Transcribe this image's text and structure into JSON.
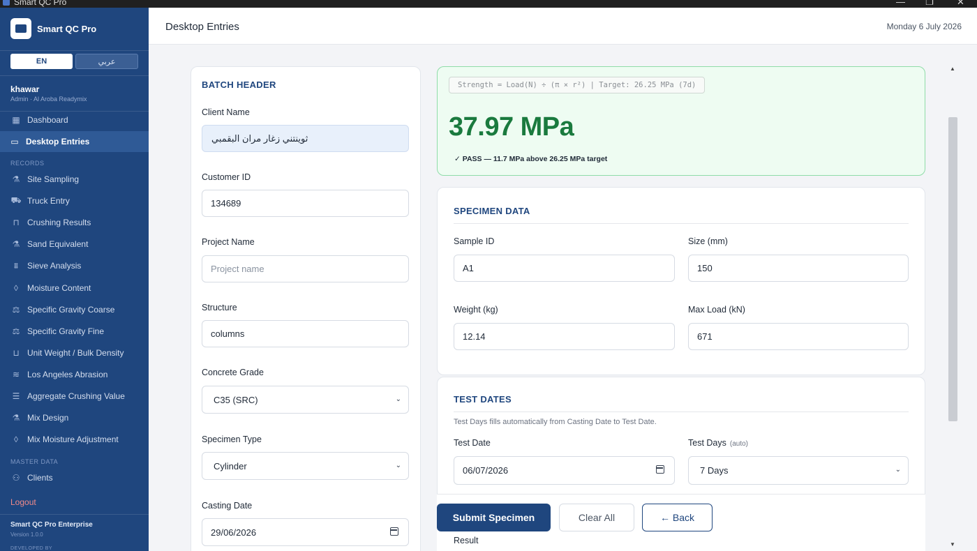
{
  "window": {
    "title": "Smart QC Pro",
    "min": "—",
    "max": "❐",
    "close": "✕"
  },
  "sidebar": {
    "brand": "Smart QC Pro",
    "lang_en": "EN",
    "lang_ar": "عربي",
    "user_name": "khawar",
    "user_role": "Admin · Al Aroba Readymix",
    "nav": [
      {
        "label": "Dashboard",
        "icon": "grid-icon",
        "glyph": "▦"
      },
      {
        "label": "Desktop Entries",
        "icon": "monitor-icon",
        "glyph": "▭"
      }
    ],
    "records_label": "RECORDS",
    "records": [
      {
        "label": "Site Sampling",
        "icon": "flask-icon",
        "glyph": "⚗"
      },
      {
        "label": "Truck Entry",
        "icon": "truck-icon",
        "glyph": "⛟"
      },
      {
        "label": "Crushing Results",
        "icon": "lock-icon",
        "glyph": "⊓"
      },
      {
        "label": "Sand Equivalent",
        "icon": "flask-icon",
        "glyph": "⚗"
      },
      {
        "label": "Sieve Analysis",
        "icon": "sieve-icon",
        "glyph": "⩩"
      },
      {
        "label": "Moisture Content",
        "icon": "droplet-icon",
        "glyph": "◊"
      },
      {
        "label": "Specific Gravity Coarse",
        "icon": "scale-icon",
        "glyph": "⚖"
      },
      {
        "label": "Specific Gravity Fine",
        "icon": "scale-icon",
        "glyph": "⚖"
      },
      {
        "label": "Unit Weight / Bulk Density",
        "icon": "beaker-icon",
        "glyph": "⊔"
      },
      {
        "label": "Los Angeles Abrasion",
        "icon": "database-icon",
        "glyph": "≋"
      },
      {
        "label": "Aggregate Crushing Value",
        "icon": "press-icon",
        "glyph": "☰"
      },
      {
        "label": "Mix Design",
        "icon": "flask-icon",
        "glyph": "⚗"
      },
      {
        "label": "Mix Moisture Adjustment",
        "icon": "droplet-icon",
        "glyph": "◊"
      }
    ],
    "master_label": "MASTER DATA",
    "master": [
      {
        "label": "Clients",
        "icon": "users-icon",
        "glyph": "⚇"
      }
    ],
    "logout": "Logout",
    "footer_title": "Smart QC Pro Enterprise",
    "footer_version": "Version 1.0.0",
    "footer_dev": "DEVELOPED BY"
  },
  "header": {
    "title": "Desktop Entries",
    "date": "Monday 6 July 2026"
  },
  "batch": {
    "title": "BATCH HEADER",
    "client_name_label": "Client Name",
    "client_name": "ثوينتني زغار مران البقمبي",
    "customer_id_label": "Customer ID",
    "customer_id": "134689",
    "project_name_label": "Project Name",
    "project_name_placeholder": "Project name",
    "structure_label": "Structure",
    "structure": "columns",
    "grade_label": "Concrete Grade",
    "grade": "C35 (SRC)",
    "specimen_type_label": "Specimen Type",
    "specimen_type": "Cylinder",
    "casting_date_label": "Casting Date",
    "casting_date": "29/06/2026"
  },
  "result": {
    "formula": "Strength = Load(N) ÷ (π × r²) | Target: 26.25 MPa (7d)",
    "strength": "37.97 MPa",
    "verdict": "✓ PASS — 11.7 MPa above 26.25 MPa target",
    "status_color": "#1a7a3e"
  },
  "specimen": {
    "title": "SPECIMEN DATA",
    "sample_id_label": "Sample ID",
    "sample_id": "A1",
    "size_label": "Size (mm)",
    "size": "150",
    "weight_label": "Weight (kg)",
    "weight": "12.14",
    "max_load_label": "Max Load (kN)",
    "max_load": "671"
  },
  "dates": {
    "title": "TEST DATES",
    "hint": "Test Days fills automatically from Casting Date to Test Date.",
    "test_date_label": "Test Date",
    "test_date": "06/07/2026",
    "test_days_label": "Test Days",
    "test_days_auto": "(auto)",
    "test_days": "7 Days"
  },
  "actions": {
    "submit": "Submit Specimen",
    "clear": "Clear All",
    "back": "← Back",
    "result_label": "Result"
  },
  "colors": {
    "sidebar": "#1f467e",
    "accent": "#1f467e",
    "pass": "#1a7a3e"
  }
}
